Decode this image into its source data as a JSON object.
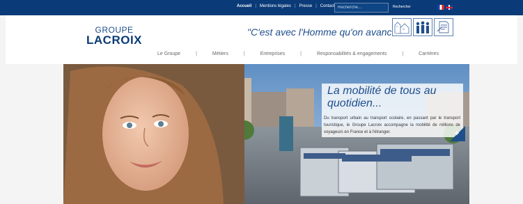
{
  "topbar": {
    "links": [
      "Accueil",
      "Mentions légales",
      "Presse",
      "Contact"
    ],
    "search": {
      "placeholder": "Recherche..."
    },
    "search_button": "Rechercher",
    "languages": [
      "fr-flag",
      "uk-flag"
    ]
  },
  "header": {
    "logo": {
      "top": "GROUPE",
      "bottom": "LACROIX"
    },
    "tagline": "\"C'est avec l'Homme qu'on avance...\"",
    "thumbnail_icons": [
      "city-sketch-icon",
      "people-icon",
      "document-icon"
    ]
  },
  "nav": {
    "items": [
      "Le Groupe",
      "Métiers",
      "Entreprises",
      "Responsabilités & engagements",
      "Carrières"
    ]
  },
  "hero": {
    "title": "La mobilité de tous au quotidien...",
    "text": "Du transport urbain au transport scolaire, en passant par le transport touristique, le Groupe Lacroix accompagne la mobilité de millions de voyageurs en France et à l'étranger.",
    "more_button": "+"
  },
  "colors": {
    "brand": "#0a3b78",
    "accent": "#1f4e8c",
    "nav_text": "#666666"
  }
}
